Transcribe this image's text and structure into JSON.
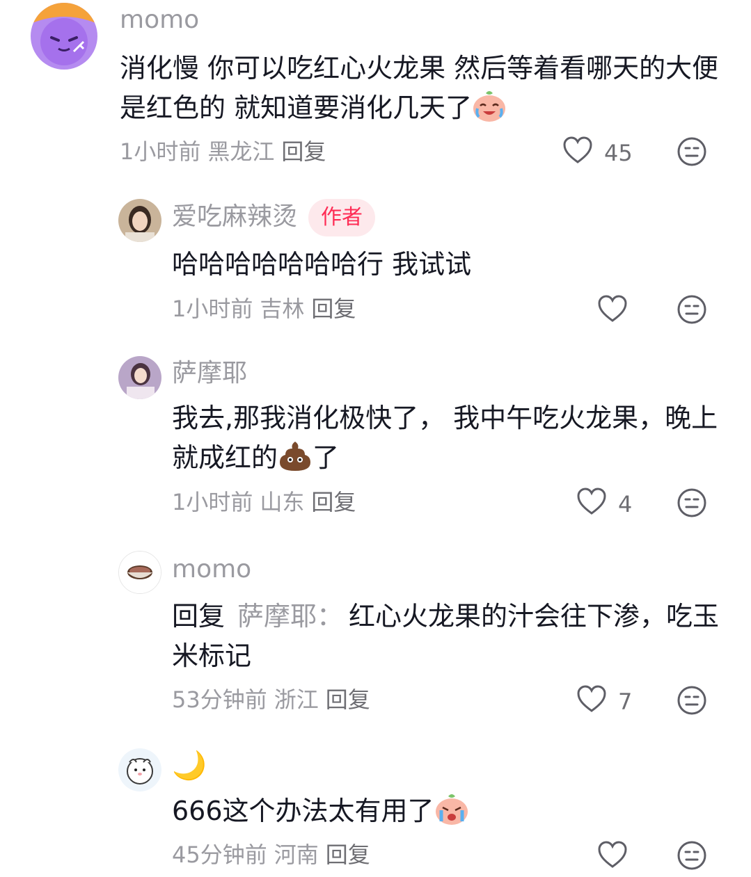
{
  "comments": [
    {
      "username": "momo",
      "text_parts": [
        "消化慢 你可以吃红心火龙果 然后等着看哪天的大便是红色的 就知道要消化几天了"
      ],
      "emoji": "crying-laugh-face-emoji",
      "time": "1小时前",
      "location": "黑龙江",
      "reply_label": "回复",
      "likes": "45"
    },
    {
      "username": "爱吃麻辣烫",
      "badge": "作者",
      "text": "哈哈哈哈哈哈哈行 我试试",
      "time": "1小时前",
      "location": "吉林",
      "reply_label": "回复",
      "likes": ""
    },
    {
      "username": "萨摩耶",
      "text_a": "我去,那我消化极快了， 我中午吃火龙果，晚上就成红的",
      "text_b": "了",
      "emoji": "poop-emoji",
      "time": "1小时前",
      "location": "山东",
      "reply_label": "回复",
      "likes": "4"
    },
    {
      "username": "momo",
      "reply_prefix": "回复",
      "reply_to": "萨摩耶：",
      "text": "红心火龙果的汁会往下渗，吃玉米标记",
      "time": "53分钟前",
      "location": "浙江",
      "reply_label": "回复",
      "likes": "7"
    },
    {
      "username": "🌙",
      "text": "666这个办法太有用了",
      "emoji": "crying-face-emoji",
      "time": "45分钟前",
      "location": "河南",
      "reply_label": "回复",
      "likes": ""
    }
  ],
  "colors": {
    "accent": "#fe2c55",
    "badge_bg": "#fde9ec",
    "text": "#161823",
    "muted": "#9a9aa0"
  }
}
